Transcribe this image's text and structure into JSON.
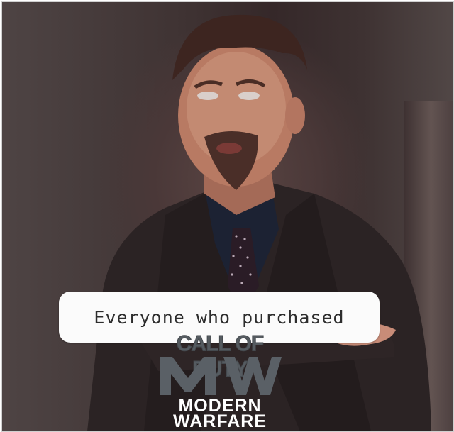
{
  "meme": {
    "caption": "Everyone who purchased",
    "logo": {
      "line1": "CALL OF DUTY",
      "mark": "MW",
      "line2": "MODERN",
      "line3": "WARFARE"
    }
  },
  "colors": {
    "background": "#3f3333",
    "caption_box": "#fbfbfb",
    "logo_gray": "#5a6066",
    "logo_text": "#ffffff"
  }
}
